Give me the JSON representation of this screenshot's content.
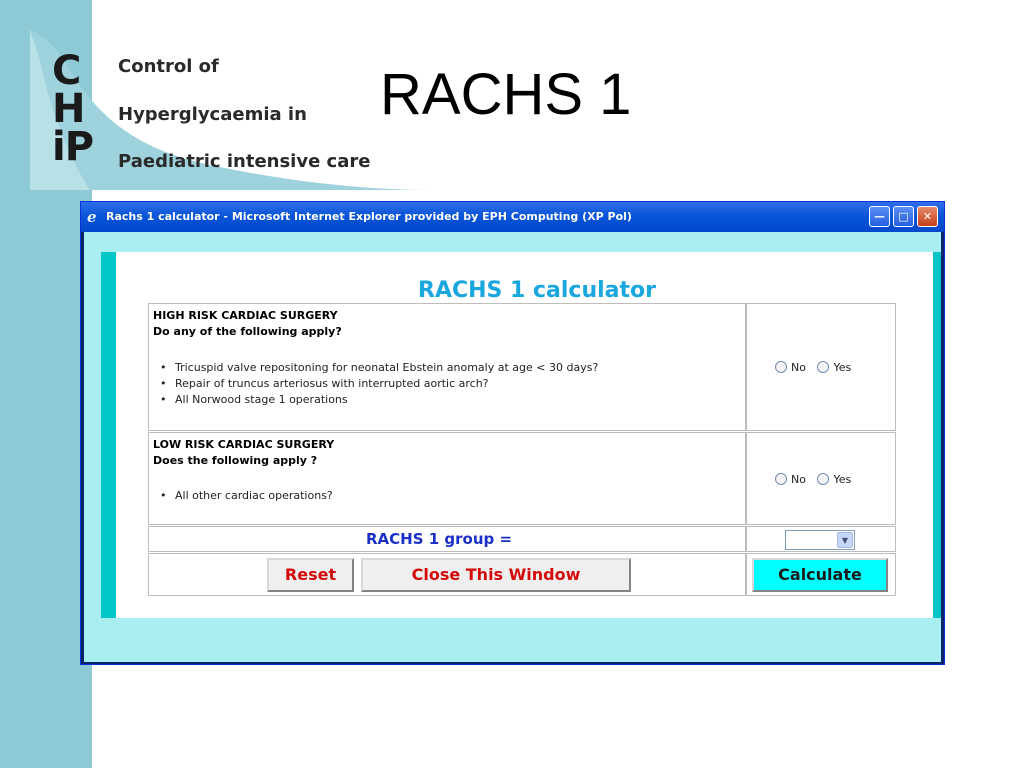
{
  "slide": {
    "title": "RACHS 1",
    "logo": {
      "letters": [
        "C",
        "H",
        "iP"
      ],
      "lines": [
        "Control of",
        "Hyperglycaemia in",
        "Paediatric intensive care"
      ]
    },
    "colors": {
      "left_strip": "#8ec9d6",
      "logo_wave": "#9ed2dc"
    }
  },
  "window": {
    "title": "Rachs 1 calculator - Microsoft Internet Explorer provided by EPH Computing (XP Pol)",
    "icon": "ie-logo-icon",
    "controls": [
      "minimize-icon",
      "maximize-icon",
      "close-icon"
    ]
  },
  "calculator": {
    "heading": "RACHS 1 calculator",
    "questions": [
      {
        "title": "HIGH RISK CARDIAC SURGERY",
        "subtitle": "Do any of the following apply?",
        "items": [
          "Tricuspid valve repositoning for neonatal Ebstein anomaly at age < 30 days?",
          "Repair of truncus arteriosus with interrupted aortic arch?",
          "All Norwood stage 1 operations"
        ],
        "options": [
          "No",
          "Yes"
        ]
      },
      {
        "title": "LOW RISK CARDIAC SURGERY",
        "subtitle": "Does the following apply ?",
        "items": [
          "All other cardiac operations?"
        ],
        "options": [
          "No",
          "Yes"
        ]
      }
    ],
    "group_label": "RACHS 1 group =",
    "group_value": "",
    "buttons": {
      "reset": "Reset",
      "close": "Close This Window",
      "calculate": "Calculate"
    },
    "colors": {
      "heading": "#1aa7e0",
      "group_label": "#1a2ec8",
      "button_text": "#d40a0a",
      "calculate_bg": "#00ffff",
      "frame": "#00c6c6"
    }
  }
}
